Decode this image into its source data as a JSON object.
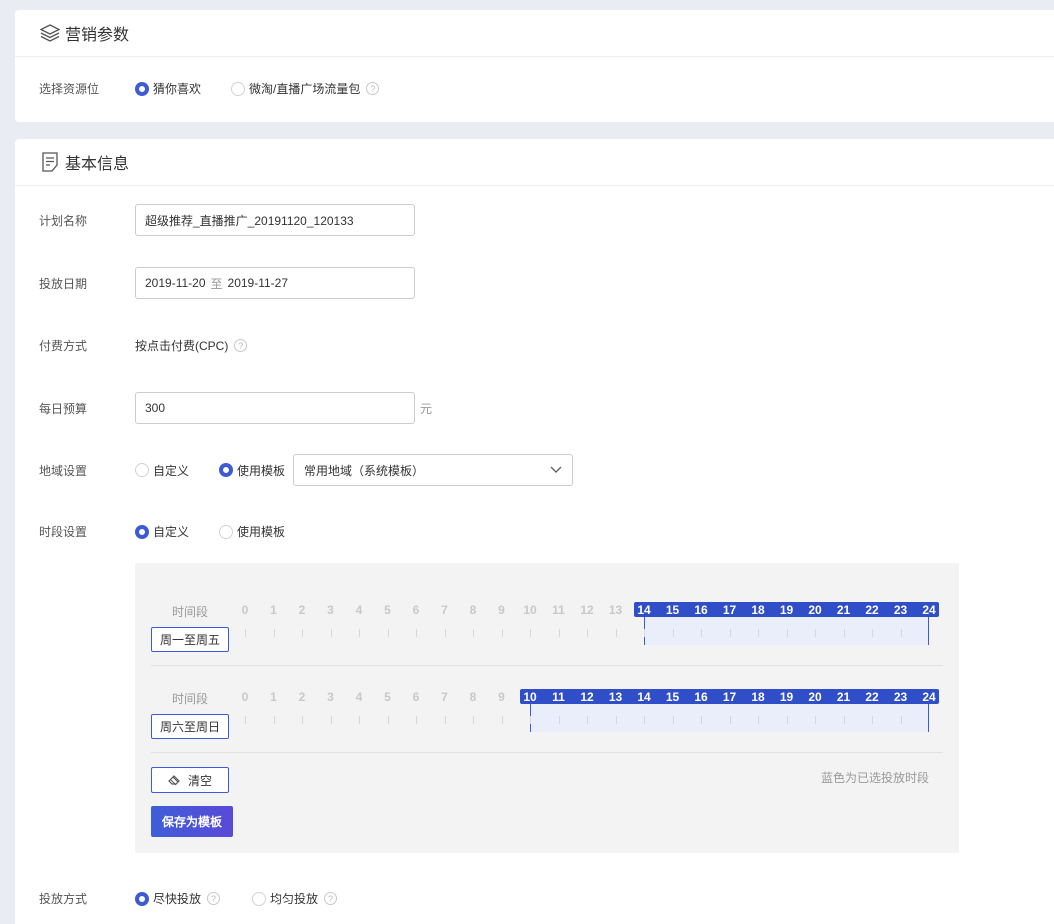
{
  "marketing": {
    "title": "营销参数",
    "resource_label": "选择资源位",
    "options": [
      "猜你喜欢",
      "微淘/直播广场流量包"
    ]
  },
  "basic": {
    "title": "基本信息",
    "plan_name_label": "计划名称",
    "plan_name_value": "超级推荐_直播推广_20191120_120133",
    "date_label": "投放日期",
    "date_start": "2019-11-20",
    "date_sep": "至",
    "date_end": "2019-11-27",
    "pay_label": "付费方式",
    "pay_value": "按点击付费(CPC)",
    "budget_label": "每日预算",
    "budget_value": "300",
    "budget_unit": "元",
    "region_label": "地域设置",
    "region_options": [
      "自定义",
      "使用模板"
    ],
    "region_template": "常用地域（系统模板）",
    "time_label": "时段设置",
    "time_options": [
      "自定义",
      "使用模板"
    ],
    "delivery_label": "投放方式",
    "delivery_options": [
      "尽快投放",
      "均匀投放"
    ]
  },
  "schedule": {
    "rows": [
      {
        "label": "时间段",
        "day_button": "周一至周五",
        "start": 14,
        "end": 24
      },
      {
        "label": "时间段",
        "day_button": "周六至周日",
        "start": 10,
        "end": 24
      }
    ],
    "clear_label": "清空",
    "save_label": "保存为模板",
    "hint": "蓝色为已选投放时段"
  },
  "colors": {
    "accent": "#3d5bd6",
    "selected_bg": "#eaeefa"
  }
}
